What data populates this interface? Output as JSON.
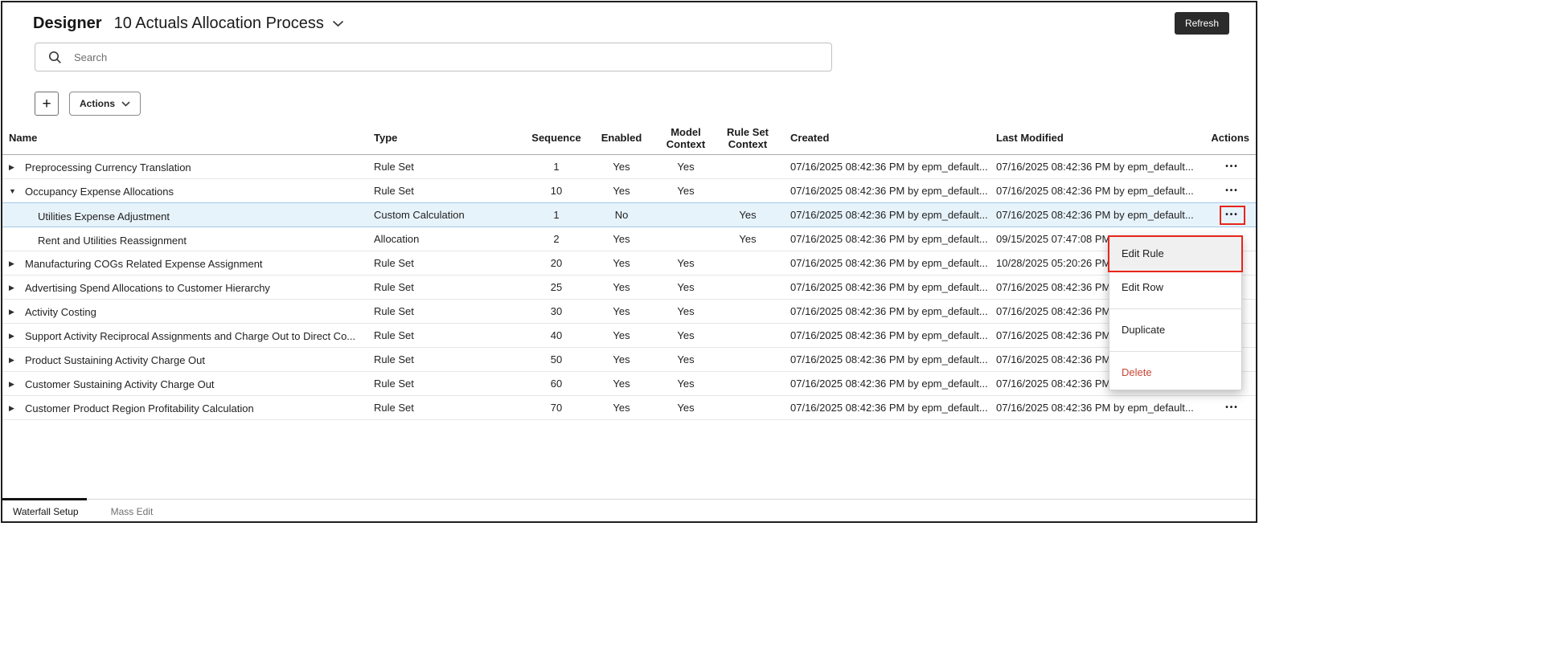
{
  "colors": {
    "annotation_red": "#e8251c",
    "danger_red": "#c74634"
  },
  "header": {
    "app_title": "Designer",
    "process_name": "10 Actuals Allocation Process",
    "refresh_label": "Refresh"
  },
  "search": {
    "placeholder": "Search"
  },
  "toolbar": {
    "add_label": "+",
    "actions_label": "Actions"
  },
  "icons": {
    "collapsed_triangle": "▶",
    "expanded_triangle": "▼",
    "row_actions": "•••"
  },
  "table": {
    "columns": [
      "Name",
      "Type",
      "Sequence",
      "Enabled",
      "Model Context",
      "Rule Set Context",
      "Created",
      "Last Modified",
      "Actions"
    ],
    "rows": [
      {
        "name": "Preprocessing Currency Translation",
        "type": "Rule Set",
        "sequence": "1",
        "enabled": "Yes",
        "model_context": "Yes",
        "rule_set_context": "",
        "created": "07/16/2025 08:42:36 PM by epm_default...",
        "last_modified": "07/16/2025 08:42:36 PM by epm_default...",
        "expand": "collapsed",
        "child": false,
        "selected": false,
        "annotated_actions": false
      },
      {
        "name": "Occupancy Expense Allocations",
        "type": "Rule Set",
        "sequence": "10",
        "enabled": "Yes",
        "model_context": "Yes",
        "rule_set_context": "",
        "created": "07/16/2025 08:42:36 PM by epm_default...",
        "last_modified": "07/16/2025 08:42:36 PM by epm_default...",
        "expand": "expanded",
        "child": false,
        "selected": false,
        "annotated_actions": false
      },
      {
        "name": "Utilities Expense Adjustment",
        "type": "Custom Calculation",
        "sequence": "1",
        "enabled": "No",
        "model_context": "",
        "rule_set_context": "Yes",
        "created": "07/16/2025 08:42:36 PM by epm_default...",
        "last_modified": "07/16/2025 08:42:36 PM by epm_default...",
        "expand": "none",
        "child": true,
        "selected": true,
        "annotated_actions": true
      },
      {
        "name": "Rent and Utilities Reassignment",
        "type": "Allocation",
        "sequence": "2",
        "enabled": "Yes",
        "model_context": "",
        "rule_set_context": "Yes",
        "created": "07/16/2025 08:42:36 PM by epm_default...",
        "last_modified": "09/15/2025 07:47:08 PM",
        "expand": "none",
        "child": true,
        "selected": false,
        "annotated_actions": false
      },
      {
        "name": "Manufacturing COGs Related Expense Assignment",
        "type": "Rule Set",
        "sequence": "20",
        "enabled": "Yes",
        "model_context": "Yes",
        "rule_set_context": "",
        "created": "07/16/2025 08:42:36 PM by epm_default...",
        "last_modified": "10/28/2025 05:20:26 PM",
        "expand": "collapsed",
        "child": false,
        "selected": false,
        "annotated_actions": false
      },
      {
        "name": "Advertising Spend Allocations to Customer Hierarchy",
        "type": "Rule Set",
        "sequence": "25",
        "enabled": "Yes",
        "model_context": "Yes",
        "rule_set_context": "",
        "created": "07/16/2025 08:42:36 PM by epm_default...",
        "last_modified": "07/16/2025 08:42:36 PM by epm_default...",
        "expand": "collapsed",
        "child": false,
        "selected": false,
        "annotated_actions": false
      },
      {
        "name": "Activity Costing",
        "type": "Rule Set",
        "sequence": "30",
        "enabled": "Yes",
        "model_context": "Yes",
        "rule_set_context": "",
        "created": "07/16/2025 08:42:36 PM by epm_default...",
        "last_modified": "07/16/2025 08:42:36 PM by epm_default...",
        "expand": "collapsed",
        "child": false,
        "selected": false,
        "annotated_actions": false
      },
      {
        "name": "Support Activity Reciprocal Assignments and Charge Out to Direct Co...",
        "type": "Rule Set",
        "sequence": "40",
        "enabled": "Yes",
        "model_context": "Yes",
        "rule_set_context": "",
        "created": "07/16/2025 08:42:36 PM by epm_default...",
        "last_modified": "07/16/2025 08:42:36 PM by epm_default...",
        "expand": "collapsed",
        "child": false,
        "selected": false,
        "annotated_actions": false
      },
      {
        "name": "Product Sustaining Activity Charge Out",
        "type": "Rule Set",
        "sequence": "50",
        "enabled": "Yes",
        "model_context": "Yes",
        "rule_set_context": "",
        "created": "07/16/2025 08:42:36 PM by epm_default...",
        "last_modified": "07/16/2025 08:42:36 PM by epm_default...",
        "expand": "collapsed",
        "child": false,
        "selected": false,
        "annotated_actions": false
      },
      {
        "name": "Customer Sustaining Activity Charge Out",
        "type": "Rule Set",
        "sequence": "60",
        "enabled": "Yes",
        "model_context": "Yes",
        "rule_set_context": "",
        "created": "07/16/2025 08:42:36 PM by epm_default...",
        "last_modified": "07/16/2025 08:42:36 PM by epm_default...",
        "expand": "collapsed",
        "child": false,
        "selected": false,
        "annotated_actions": false
      },
      {
        "name": "Customer Product Region Profitability Calculation",
        "type": "Rule Set",
        "sequence": "70",
        "enabled": "Yes",
        "model_context": "Yes",
        "rule_set_context": "",
        "created": "07/16/2025 08:42:36 PM by epm_default...",
        "last_modified": "07/16/2025 08:42:36 PM by epm_default...",
        "expand": "collapsed",
        "child": false,
        "selected": false,
        "annotated_actions": false
      }
    ]
  },
  "context_menu": {
    "items": [
      {
        "label": "Edit Rule",
        "annotated": true
      },
      {
        "label": "Edit Row"
      },
      {
        "divider": true
      },
      {
        "label": "Duplicate"
      },
      {
        "divider": true
      },
      {
        "label": "Delete",
        "danger": true
      }
    ]
  },
  "footer_tabs": [
    {
      "label": "Waterfall Setup",
      "active": true
    },
    {
      "label": "Mass Edit",
      "active": false
    }
  ]
}
